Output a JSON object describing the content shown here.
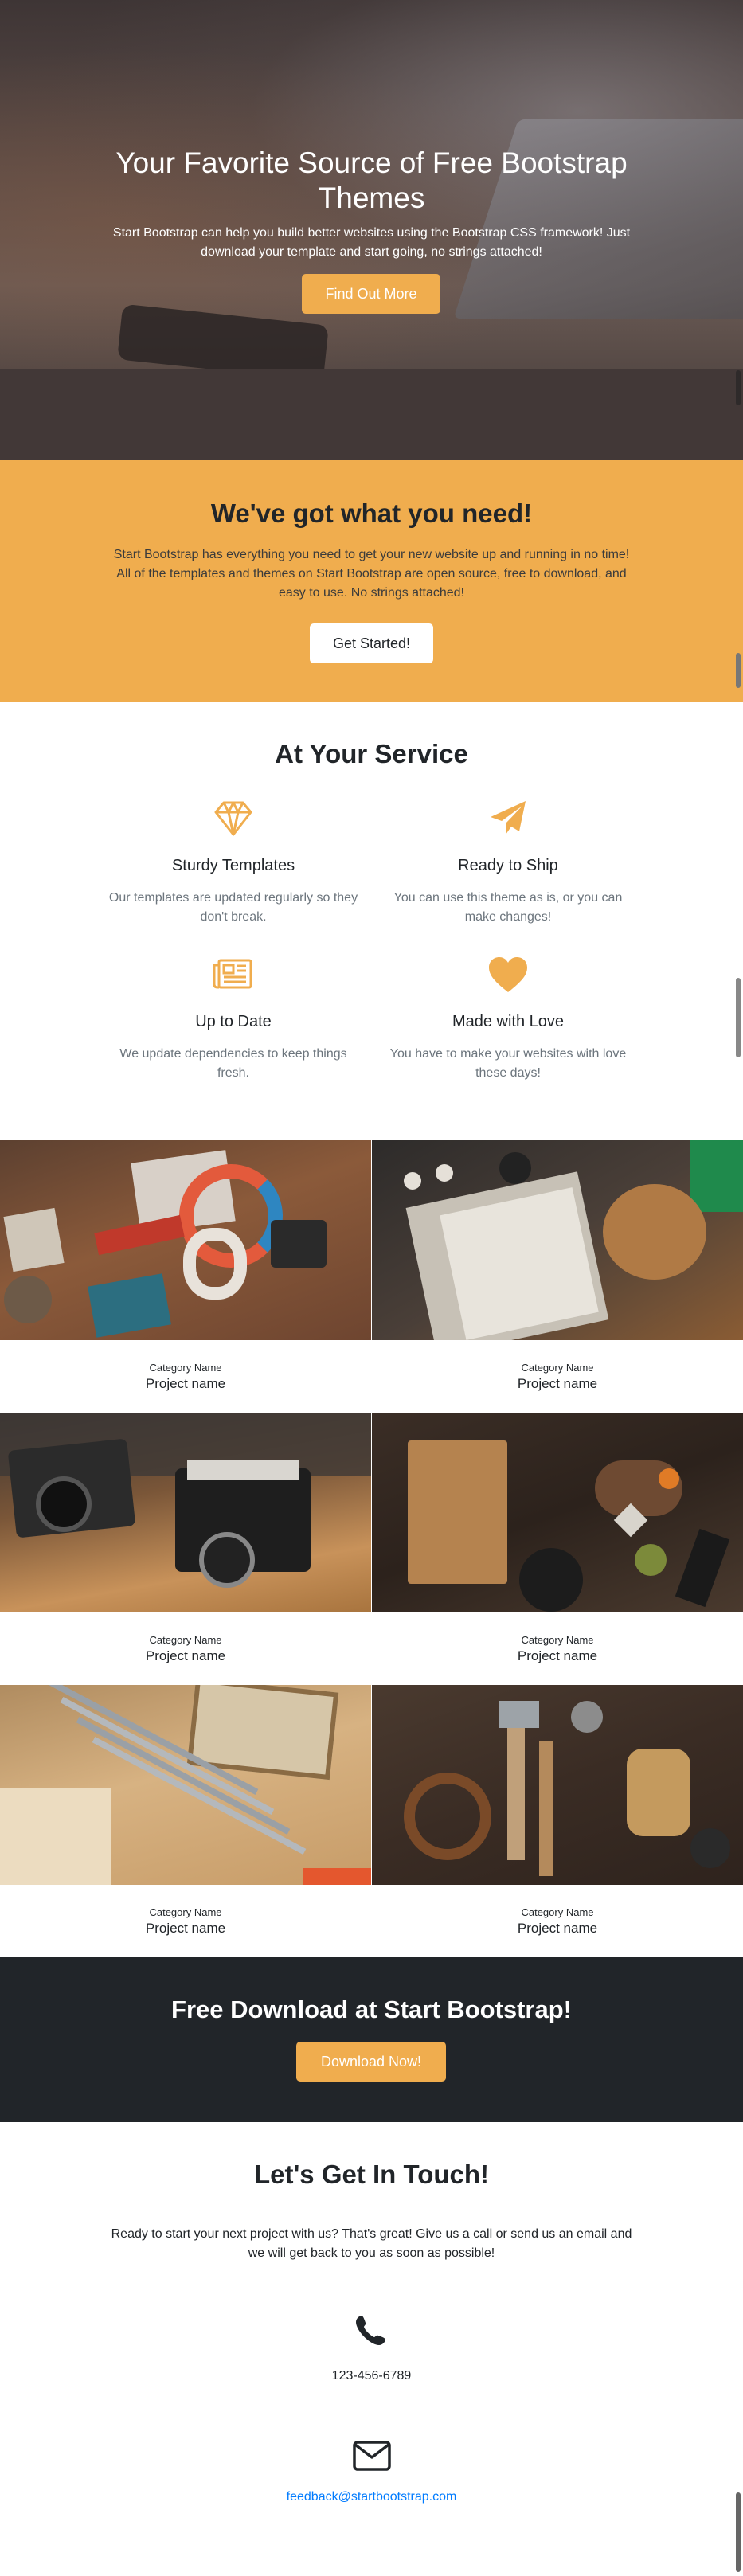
{
  "hero": {
    "title": "Your Favorite Source of Free Bootstrap Themes",
    "subtitle": "Start Bootstrap can help you build better websites using the Bootstrap CSS framework! Just download your template and start going, no strings attached!",
    "button_label": "Find Out More"
  },
  "about": {
    "title": "We've got what you need!",
    "text": "Start Bootstrap has everything you need to get your new website up and running in no time! All of the templates and themes on Start Bootstrap are open source, free to download, and easy to use. No strings attached!",
    "button_label": "Get Started!"
  },
  "services": {
    "title": "At Your Service",
    "items": [
      {
        "icon": "diamond-icon",
        "title": "Sturdy Templates",
        "text": "Our templates are updated regularly so they don't break."
      },
      {
        "icon": "paper-plane-icon",
        "title": "Ready to Ship",
        "text": "You can use this theme as is, or you can make changes!"
      },
      {
        "icon": "newspaper-icon",
        "title": "Up to Date",
        "text": "We update dependencies to keep things fresh."
      },
      {
        "icon": "heart-icon",
        "title": "Made with Love",
        "text": "You have to make your websites with love these days!"
      }
    ]
  },
  "portfolio": {
    "items": [
      {
        "category": "Category Name",
        "name": "Project name"
      },
      {
        "category": "Category Name",
        "name": "Project name"
      },
      {
        "category": "Category Name",
        "name": "Project name"
      },
      {
        "category": "Category Name",
        "name": "Project name"
      },
      {
        "category": "Category Name",
        "name": "Project name"
      },
      {
        "category": "Category Name",
        "name": "Project name"
      }
    ]
  },
  "download": {
    "title": "Free Download at Start Bootstrap!",
    "button_label": "Download Now!"
  },
  "contact": {
    "title": "Let's Get In Touch!",
    "text": "Ready to start your next project with us? That's great! Give us a call or send us an email and we will get back to you as soon as possible!",
    "phone": "123-456-6789",
    "email": "feedback@startbootstrap.com"
  },
  "colors": {
    "accent": "#f0ad4e",
    "dark": "#212529",
    "link": "#007bff",
    "muted": "#6c757d"
  }
}
